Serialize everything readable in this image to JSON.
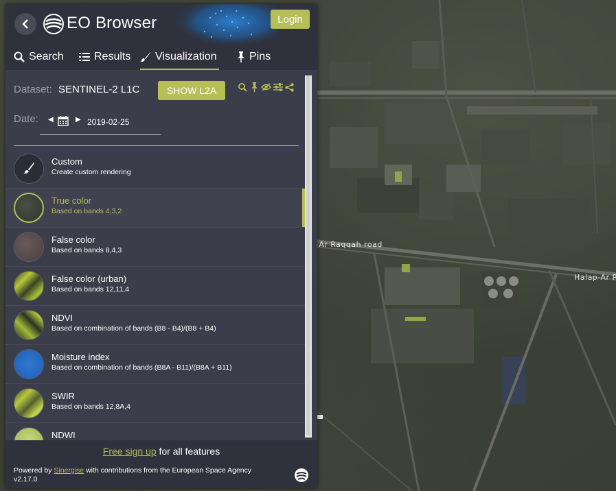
{
  "app": {
    "title": "EO Browser",
    "login_label": "Login"
  },
  "tabs": [
    {
      "label": "Search",
      "icon": "search-icon"
    },
    {
      "label": "Results",
      "icon": "list-icon"
    },
    {
      "label": "Visualization",
      "icon": "brush-icon",
      "active": true
    },
    {
      "label": "Pins",
      "icon": "pin-icon"
    }
  ],
  "dataset": {
    "label": "Dataset:",
    "value": "SENTINEL-2 L1C",
    "button": "SHOW L2A"
  },
  "date": {
    "label": "Date:",
    "value": "2019-02-25"
  },
  "layers": [
    {
      "name": "Custom",
      "desc": "Create custom rendering",
      "thumb": "custom"
    },
    {
      "name": "True color",
      "desc": "Based on bands 4,3,2",
      "thumb": "true",
      "active": true
    },
    {
      "name": "False color",
      "desc": "Based on bands 8,4,3",
      "thumb": "false"
    },
    {
      "name": "False color (urban)",
      "desc": "Based on bands 12,11,4",
      "thumb": "urban"
    },
    {
      "name": "NDVI",
      "desc": "Based on combination of bands (B8 - B4)/(B8 + B4)",
      "thumb": "ndvi"
    },
    {
      "name": "Moisture index",
      "desc": "Based on combination of bands (B8A - B11)/(B8A + B11)",
      "thumb": "moisture"
    },
    {
      "name": "SWIR",
      "desc": "Based on bands 12,8A,4",
      "thumb": "swir"
    },
    {
      "name": "NDWI",
      "desc": "",
      "thumb": "ndwi"
    }
  ],
  "footer": {
    "signup_link": "Free sign up",
    "signup_rest": " for all features",
    "powered_pre": "Powered by ",
    "powered_link": "Sinergise",
    "powered_post": " with contributions from the European Space Agency",
    "version": "v2.17.0"
  },
  "map": {
    "road_labels": [
      "-Ar Raqqah road",
      "Halap-Ar Raqq"
    ]
  },
  "colors": {
    "accent": "#b6bf57",
    "panel": "#3b3d4a",
    "header": "#2f313c"
  }
}
